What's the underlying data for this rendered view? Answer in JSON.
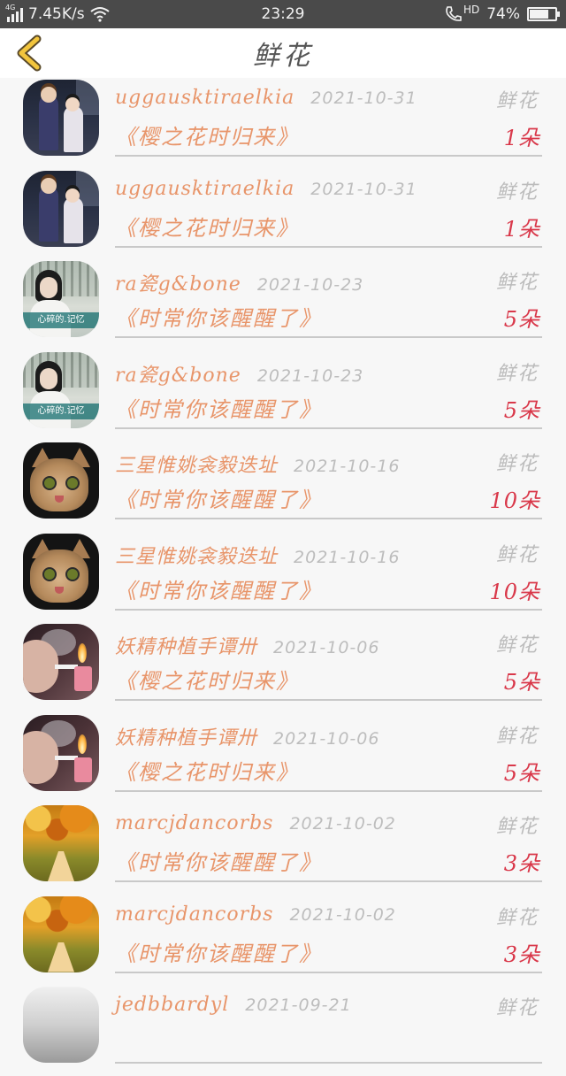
{
  "status_bar": {
    "network": "4G",
    "speed": "7.45K/s",
    "time": "23:29",
    "hd": "HD",
    "battery": "74%",
    "battery_level": 0.74
  },
  "header": {
    "title": "鲜花",
    "back_icon": "chevron-left-icon"
  },
  "colors": {
    "accent_orange": "#e8956a",
    "count_red": "#d9384a",
    "date_gray": "#bdbdbd",
    "back_yellow": "#f2c53d"
  },
  "items": [
    {
      "user": "uggausktiraelkia",
      "date": "2021-10-31",
      "gift": "鲜花",
      "song": "《樱之花时归来》",
      "count": "1朵",
      "avatar": "anime"
    },
    {
      "user": "uggausktiraelkia",
      "date": "2021-10-31",
      "gift": "鲜花",
      "song": "《樱之花时归来》",
      "count": "1朵",
      "avatar": "anime"
    },
    {
      "user": "ra瓷g&bone",
      "date": "2021-10-23",
      "gift": "鲜花",
      "song": "《时常你该醒醒了》",
      "count": "5朵",
      "avatar": "girl"
    },
    {
      "user": "ra瓷g&bone",
      "date": "2021-10-23",
      "gift": "鲜花",
      "song": "《时常你该醒醒了》",
      "count": "5朵",
      "avatar": "girl"
    },
    {
      "user": "三星惟姚衾毅迭址",
      "date": "2021-10-16",
      "gift": "鲜花",
      "song": "《时常你该醒醒了》",
      "count": "10朵",
      "avatar": "cat"
    },
    {
      "user": "三星惟姚衾毅迭址",
      "date": "2021-10-16",
      "gift": "鲜花",
      "song": "《时常你该醒醒了》",
      "count": "10朵",
      "avatar": "cat"
    },
    {
      "user": "妖精种植手谭卅",
      "date": "2021-10-06",
      "gift": "鲜花",
      "song": "《樱之花时归来》",
      "count": "5朵",
      "avatar": "smoke"
    },
    {
      "user": "妖精种植手谭卅",
      "date": "2021-10-06",
      "gift": "鲜花",
      "song": "《樱之花时归来》",
      "count": "5朵",
      "avatar": "smoke"
    },
    {
      "user": "marcjdancorbs",
      "date": "2021-10-02",
      "gift": "鲜花",
      "song": "《时常你该醒醒了》",
      "count": "3朵",
      "avatar": "autumn"
    },
    {
      "user": "marcjdancorbs",
      "date": "2021-10-02",
      "gift": "鲜花",
      "song": "《时常你该醒醒了》",
      "count": "3朵",
      "avatar": "autumn"
    },
    {
      "user": "jedbbardyl",
      "date": "2021-09-21",
      "gift": "鲜花",
      "song": "",
      "count": "",
      "avatar": "bw"
    }
  ],
  "avatar_captions": {
    "girl": "心碎的.记忆"
  }
}
